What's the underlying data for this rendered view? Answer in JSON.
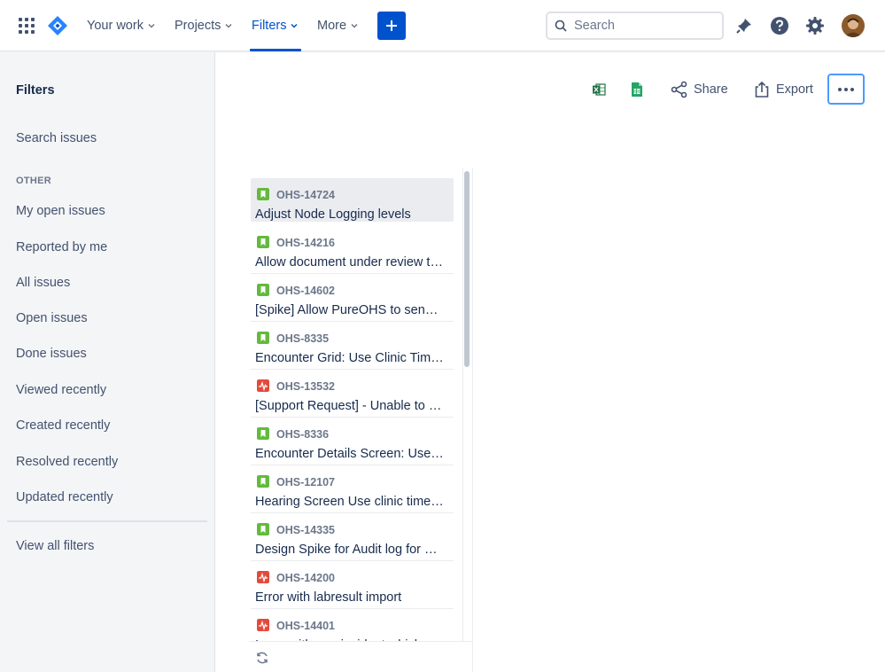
{
  "nav": {
    "your_work": "Your work",
    "projects": "Projects",
    "filters": "Filters",
    "more": "More",
    "search_placeholder": "Search"
  },
  "sidebar": {
    "title": "Filters",
    "search_issues": "Search issues",
    "section_label": "OTHER",
    "items": [
      {
        "label": "My open issues"
      },
      {
        "label": "Reported by me"
      },
      {
        "label": "All issues"
      },
      {
        "label": "Open issues"
      },
      {
        "label": "Done issues"
      },
      {
        "label": "Viewed recently"
      },
      {
        "label": "Created recently"
      },
      {
        "label": "Resolved recently"
      },
      {
        "label": "Updated recently"
      }
    ],
    "view_all": "View all filters"
  },
  "toolbar": {
    "share": "Share",
    "export": "Export"
  },
  "issues": [
    {
      "key": "OHS-14724",
      "summary": "Adjust Node Logging levels",
      "type": "story"
    },
    {
      "key": "OHS-14216",
      "summary": "Allow document under review to be…",
      "type": "story"
    },
    {
      "key": "OHS-14602",
      "summary": "[Spike] Allow PureOHS to send emails",
      "type": "story"
    },
    {
      "key": "OHS-8335",
      "summary": "Encounter Grid: Use Clinic Time Zone",
      "type": "story"
    },
    {
      "key": "OHS-13532",
      "summary": "[Support Request] - Unable to process",
      "type": "bug"
    },
    {
      "key": "OHS-8336",
      "summary": "Encounter Details Screen: Use clinic",
      "type": "story"
    },
    {
      "key": "OHS-12107",
      "summary": "Hearing Screen Use clinic time zone",
      "type": "story"
    },
    {
      "key": "OHS-14335",
      "summary": "Design Spike for Audit log for Events",
      "type": "story"
    },
    {
      "key": "OHS-14200",
      "summary": "Error with labresult import",
      "type": "bug"
    },
    {
      "key": "OHS-14401",
      "summary": "Issue with one incident which was",
      "type": "bug"
    }
  ],
  "colors": {
    "accent": "#0052CC",
    "story": "#63BA3C",
    "bug": "#E5493A"
  }
}
